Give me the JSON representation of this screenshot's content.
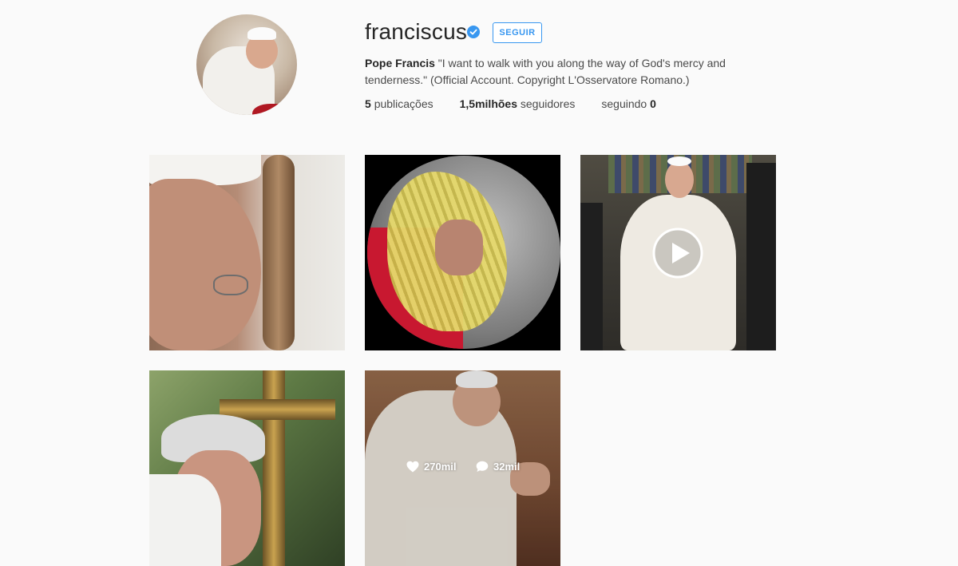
{
  "profile": {
    "username": "franciscus",
    "follow_label": "SEGUIR",
    "bio_name": "Pope Francis",
    "bio_text": " \"I want to walk with you along the way of God's mercy and tenderness.\" (Official Account. Copyright L'Osservatore Romano.)",
    "stats": {
      "posts_count": "5",
      "posts_label": "publicações",
      "followers_count": "1,5milhões",
      "followers_label": "seguidores",
      "following_label": "seguindo",
      "following_count": "0"
    },
    "verified_color": "#3897f0"
  },
  "posts": [
    {
      "type": "photo"
    },
    {
      "type": "photo"
    },
    {
      "type": "video"
    },
    {
      "type": "photo"
    },
    {
      "type": "photo",
      "hovered": true,
      "likes": "270mil",
      "comments": "32mil"
    }
  ]
}
